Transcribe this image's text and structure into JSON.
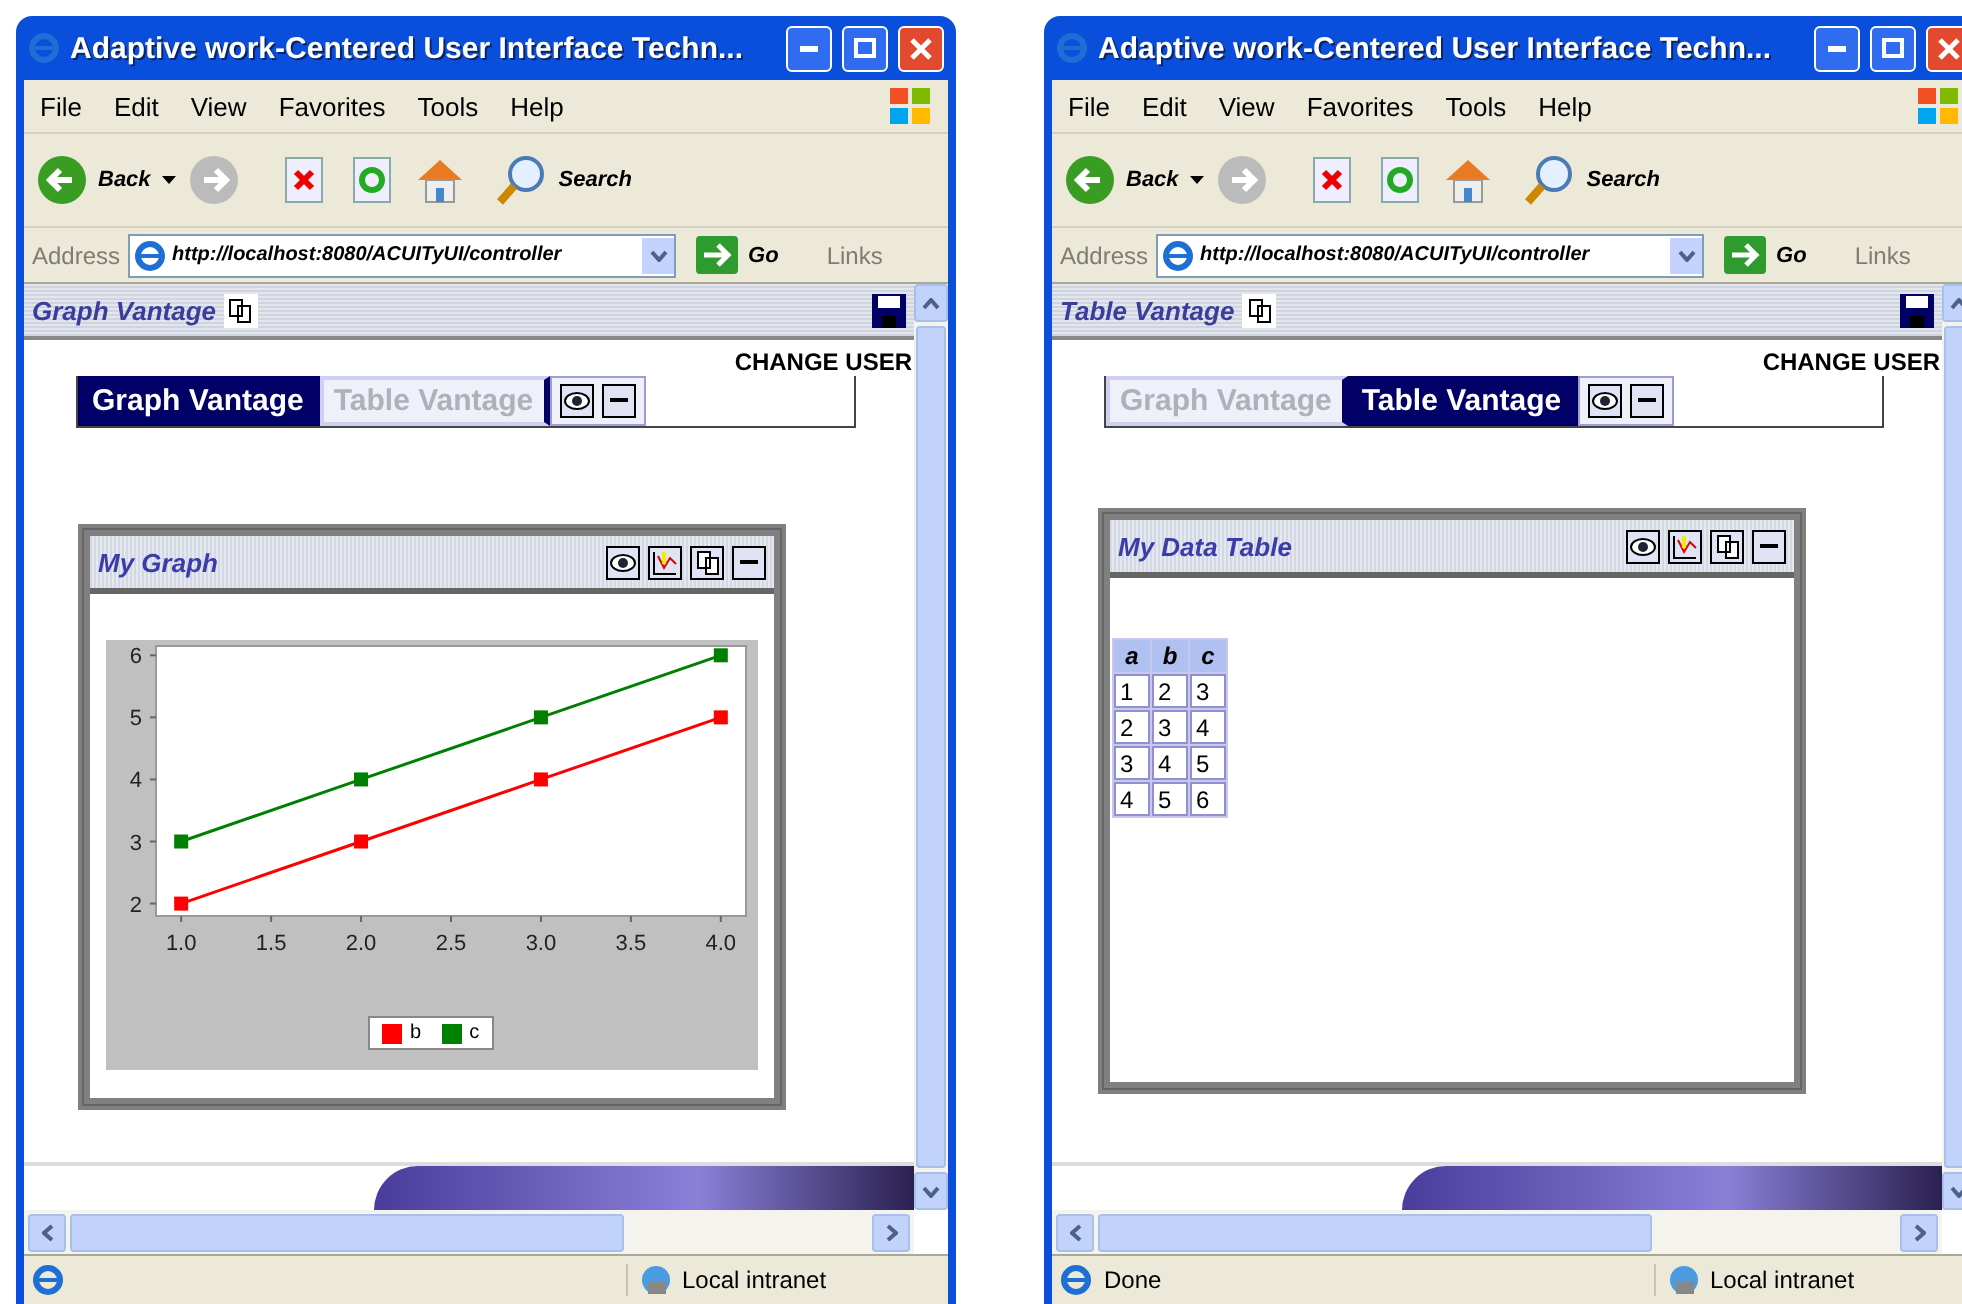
{
  "windows": [
    {
      "title": "Adaptive work-Centered User Interface Techn...",
      "menu": [
        "File",
        "Edit",
        "View",
        "Favorites",
        "Tools",
        "Help"
      ],
      "toolbar": {
        "back": "Back",
        "search": "Search"
      },
      "address": {
        "label": "Address",
        "value": "http://localhost:8080/ACUITyUI/controller",
        "go": "Go",
        "links": "Links"
      },
      "page": {
        "vantage_title": "Graph Vantage",
        "change_user": "CHANGE USER",
        "tabs": [
          {
            "label": "Graph Vantage",
            "selected": true
          },
          {
            "label": "Table Vantage",
            "selected": false
          }
        ],
        "panel": {
          "kind": "graph",
          "title": "My Graph",
          "chart_data": {
            "type": "line",
            "x": [
              1,
              2,
              3,
              4
            ],
            "xlim": [
              0.86,
              4.14
            ],
            "ylim": [
              1.8,
              6.15
            ],
            "xticks": [
              {
                "value": 1,
                "label": "1.0"
              },
              {
                "value": 1.5,
                "label": "1.5"
              },
              {
                "value": 2,
                "label": "2.0"
              },
              {
                "value": 2.5,
                "label": "2.5"
              },
              {
                "value": 3,
                "label": "3.0"
              },
              {
                "value": 3.5,
                "label": "3.5"
              },
              {
                "value": 4,
                "label": "4.0"
              }
            ],
            "yticks": [
              2,
              3,
              4,
              5,
              6
            ],
            "series": [
              {
                "name": "b",
                "color": "#ff0000",
                "marker": "square",
                "values": [
                  2,
                  3,
                  4,
                  5
                ]
              },
              {
                "name": "c",
                "color": "#008000",
                "marker": "square",
                "values": [
                  3,
                  4,
                  5,
                  6
                ]
              }
            ]
          }
        }
      },
      "status": {
        "zone": "Local intranet"
      }
    },
    {
      "title": "Adaptive work-Centered User Interface Techn...",
      "menu": [
        "File",
        "Edit",
        "View",
        "Favorites",
        "Tools",
        "Help"
      ],
      "toolbar": {
        "back": "Back",
        "search": "Search"
      },
      "address": {
        "label": "Address",
        "value": "http://localhost:8080/ACUITyUI/controller",
        "go": "Go",
        "links": "Links"
      },
      "page": {
        "vantage_title": "Table Vantage",
        "change_user": "CHANGE USER",
        "tabs": [
          {
            "label": "Graph Vantage",
            "selected": false
          },
          {
            "label": "Table Vantage",
            "selected": true
          }
        ],
        "panel": {
          "kind": "table",
          "title": "My Data Table",
          "table": {
            "columns": [
              "a",
              "b",
              "c"
            ],
            "rows": [
              [
                "1",
                "2",
                "3"
              ],
              [
                "2",
                "3",
                "4"
              ],
              [
                "3",
                "4",
                "5"
              ],
              [
                "4",
                "5",
                "6"
              ]
            ]
          }
        }
      },
      "status": {
        "text": "Done",
        "zone": "Local intranet"
      }
    }
  ]
}
